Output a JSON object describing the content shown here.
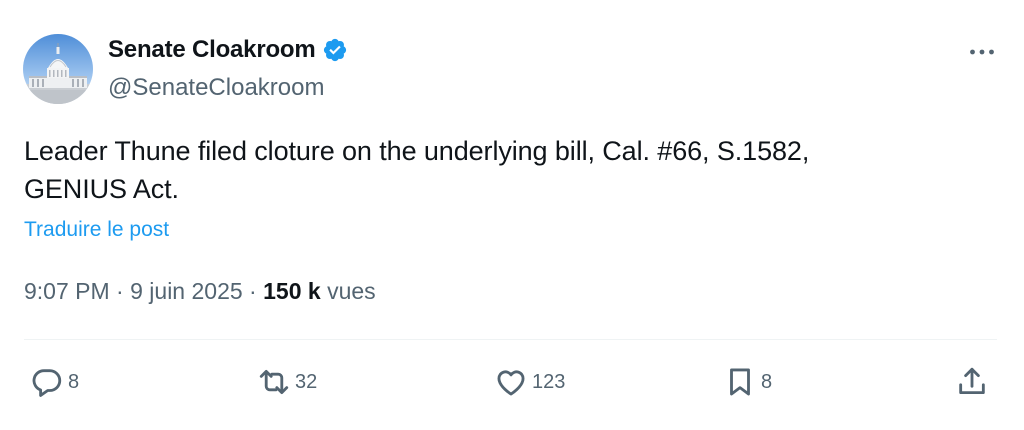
{
  "author": {
    "display_name": "Senate Cloakroom",
    "handle": "@SenateCloakroom",
    "avatar_icon": "capitol-dome-icon",
    "verified_icon": "verified-badge-icon"
  },
  "tweet": {
    "text_line1": "Leader Thune filed cloture on the underlying bill, Cal. #66, S.1582,",
    "text_line2": "GENIUS Act.",
    "translate_label": "Traduire le post"
  },
  "meta": {
    "time": "9:07 PM",
    "separator1": " · ",
    "date": "9 juin 2025",
    "separator2": " · ",
    "views_count": "150 k",
    "views_label": "vues"
  },
  "actions": {
    "replies": "8",
    "reposts": "32",
    "likes": "123",
    "bookmarks": "8"
  },
  "colors": {
    "accent": "#1d9bf0",
    "secondary_text": "#536471",
    "primary_text": "#0f1419"
  }
}
